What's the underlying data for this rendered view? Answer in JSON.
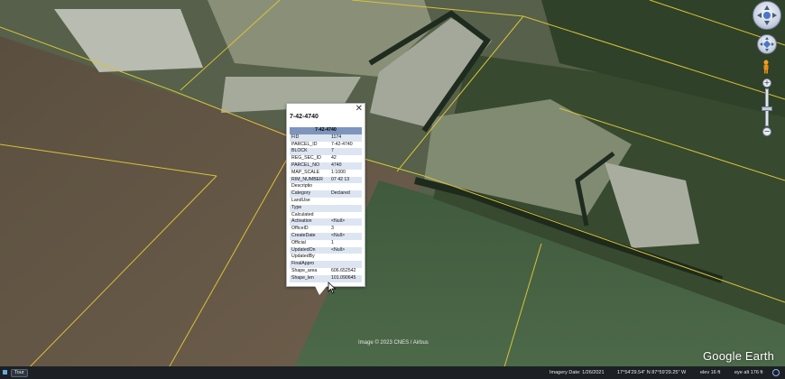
{
  "popup": {
    "title": "7-42-4740",
    "close_icon": "close-icon",
    "header": "7-42-4740",
    "rows": [
      {
        "key": "FID",
        "value": "1174"
      },
      {
        "key": "PARCEL_ID",
        "value": "7-42-4740"
      },
      {
        "key": "BLOCK",
        "value": "7"
      },
      {
        "key": "REG_SEC_ID",
        "value": "42"
      },
      {
        "key": "PARCEL_NO",
        "value": "4740"
      },
      {
        "key": "MAP_SCALE",
        "value": "1:1000"
      },
      {
        "key": "RIM_NUMBER",
        "value": "07 42 13"
      },
      {
        "key": "Descriptio",
        "value": ""
      },
      {
        "key": "Category",
        "value": "Declared"
      },
      {
        "key": "LandUse",
        "value": ""
      },
      {
        "key": "Type",
        "value": ""
      },
      {
        "key": "Calculated",
        "value": ""
      },
      {
        "key": "Activation",
        "value": "<Null>"
      },
      {
        "key": "OfficeID",
        "value": "3"
      },
      {
        "key": "CreateDate",
        "value": "<Null>"
      },
      {
        "key": "Official",
        "value": "1"
      },
      {
        "key": "UpdatedOn",
        "value": "<Null>"
      },
      {
        "key": "UpdatedBy",
        "value": ""
      },
      {
        "key": "FinalAppro",
        "value": ""
      },
      {
        "key": "Shape_area",
        "value": "606.652542"
      },
      {
        "key": "Shape_len",
        "value": "101.090645"
      }
    ]
  },
  "map": {
    "attribution": "Image © 2023 CNES / Airbus",
    "logo": "Google Earth"
  },
  "status_bar": {
    "tour_label": "Tour",
    "imagery_date": "Imagery Date: 1/26/2021",
    "coordinates": "17°54'29.54\" N   87°59'29.25\" W",
    "elevation": "elev    16 ft",
    "eye_alt": "eye alt   176 ft"
  },
  "colors": {
    "popup_header": "#7d95bd",
    "popup_alt_row": "#dde5f2",
    "parcel_lines": "#d8c238",
    "status_bar_bg": "#1c2024"
  },
  "controls": {
    "look_icon": "compass-look-icon",
    "pan_icon": "pan-control-icon",
    "street_view_icon": "pegman-icon",
    "zoom_in": "+",
    "zoom_out": "−"
  }
}
